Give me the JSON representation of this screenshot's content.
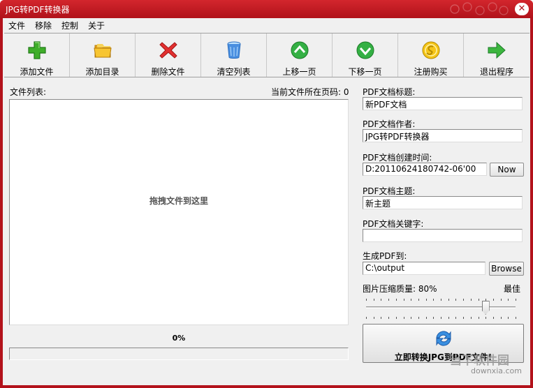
{
  "window": {
    "title": "JPG转PDF转换器",
    "close_glyph": "✕"
  },
  "menu": [
    "文件",
    "移除",
    "控制",
    "关于"
  ],
  "toolbar": [
    {
      "label": "添加文件",
      "icon": "plus-icon"
    },
    {
      "label": "添加目录",
      "icon": "folder-icon"
    },
    {
      "label": "删除文件",
      "icon": "delete-x-icon"
    },
    {
      "label": "清空列表",
      "icon": "clear-bin-icon"
    },
    {
      "label": "上移一页",
      "icon": "arrow-up-icon"
    },
    {
      "label": "下移一页",
      "icon": "arrow-down-icon"
    },
    {
      "label": "注册购买",
      "icon": "coin-icon"
    },
    {
      "label": "退出程序",
      "icon": "exit-arrow-icon"
    }
  ],
  "file_list": {
    "label": "文件列表:",
    "page_label": "当前文件所在页码: 0",
    "drop_hint": "拖拽文件到这里"
  },
  "progress": {
    "text": "0%",
    "value": 0
  },
  "pdf": {
    "title_label": "PDF文档标题:",
    "title_value": "新PDF文档",
    "author_label": "PDF文档作者:",
    "author_value": "JPG转PDF转换器",
    "created_label": "PDF文档创建时间:",
    "created_value": "D:20110624180742-06'00",
    "now_button": "Now",
    "subject_label": "PDF文档主题:",
    "subject_value": "新主题",
    "keywords_label": "PDF文档关键字:",
    "keywords_value": "",
    "output_label": "生成PDF到:",
    "output_value": "C:\\output",
    "browse_button": "Browse",
    "quality_label": "图片压缩质量: 80%",
    "quality_best": "最佳",
    "quality_value": 80
  },
  "convert_button": "立即转换JPG到PDF文件!",
  "watermark": {
    "main": "当下软件园",
    "sub": "downxia.com"
  },
  "colors": {
    "title_bar": "#c0161f",
    "window_bg": "#f0f0f0",
    "progress_fill": "#33a33c"
  }
}
